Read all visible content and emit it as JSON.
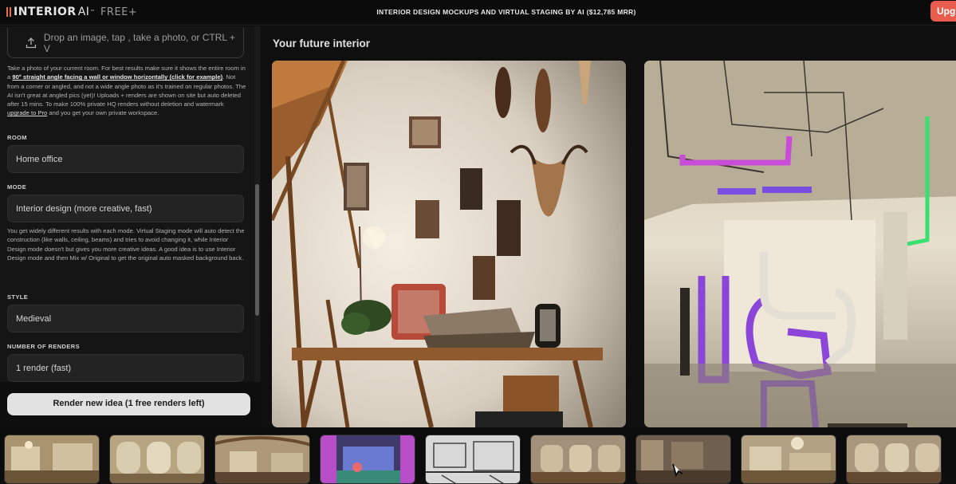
{
  "header": {
    "brand": "INTERIOR",
    "brand_ai": "AI",
    "brand_tm": "™",
    "brand_tier": "FREE+",
    "banner": "INTERIOR DESIGN MOCKUPS AND VIRTUAL STAGING BY AI ($12,785 MRR)",
    "upgrade_label": "Upgr",
    "accent_color": "#e95d4f"
  },
  "sidebar": {
    "upload_placeholder": "Drop an image, tap , take a photo, or CTRL + V",
    "upload_icon": "upload-icon",
    "info": {
      "part1": "Take a photo of your current room. For best results make sure it shows the entire room in a ",
      "bold_link": "90° straight angle facing a wall or window horizontally (click for example)",
      "part2": ". Not from a corner or angled, and not a wide angle photo as it's trained on regular photos. The AI isn't great at angled pics (yet)! Uploads + renders are shown on site but auto deleted after 15 mins. To make 100% private HQ renders without deletion and watermark ",
      "upgrade_link": "upgrade to Pro",
      "part3": " and you get your own private workspace."
    },
    "room": {
      "label": "ROOM",
      "value": "Home office"
    },
    "mode": {
      "label": "MODE",
      "value": "Interior design (more creative, fast)",
      "help": "You get widely different results with each mode. Virtual Staging mode will auto detect the construction (like walls, ceiling, beams) and tries to avoid changing it, while Interior Design mode doesn't but gives you more creative ideas. A good idea is to use Interior Design mode and then Mix w/ Original to get the original auto masked background back."
    },
    "style": {
      "label": "STYLE",
      "value": "Medieval"
    },
    "renders": {
      "label": "NUMBER OF RENDERS",
      "value": "1 render (fast)"
    },
    "render_button": "Render new idea (1 free renders left)"
  },
  "main": {
    "title": "Your future interior",
    "images": [
      {
        "name": "render-image-1",
        "description": "Home office interior render with wooden desk and wall decor"
      },
      {
        "name": "render-image-2",
        "description": "Room render with neon purple and green pipes"
      }
    ]
  },
  "thumbnails": [
    {
      "name": "thumb-1"
    },
    {
      "name": "thumb-2"
    },
    {
      "name": "thumb-3"
    },
    {
      "name": "thumb-4"
    },
    {
      "name": "thumb-5"
    },
    {
      "name": "thumb-6"
    },
    {
      "name": "thumb-7"
    },
    {
      "name": "thumb-8"
    },
    {
      "name": "thumb-9"
    }
  ]
}
